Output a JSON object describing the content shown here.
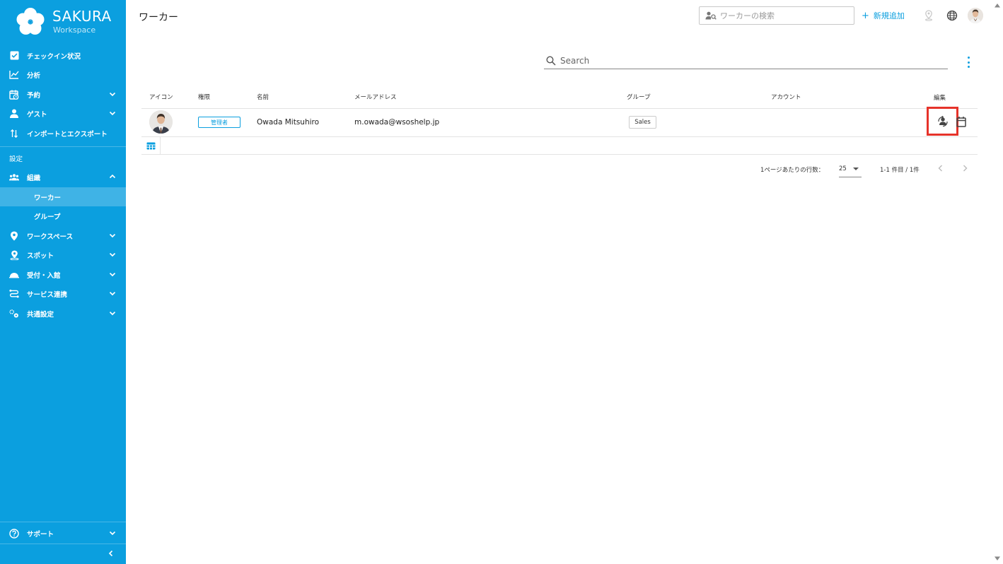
{
  "brand": {
    "title": "SAKURA",
    "subtitle": "Workspace"
  },
  "sidebar": {
    "items": [
      {
        "label": "チェックイン状況",
        "icon": "checkbox-icon"
      },
      {
        "label": "分析",
        "icon": "analytics-icon"
      },
      {
        "label": "予約",
        "icon": "calendar-clock-icon"
      },
      {
        "label": "ゲスト",
        "icon": "guest-icon"
      },
      {
        "label": "インポートとエクスポート",
        "icon": "import-export-icon"
      }
    ],
    "settings_label": "設定",
    "org": {
      "label": "組織",
      "icon": "people-icon"
    },
    "org_children": [
      {
        "label": "ワーカー",
        "active": true
      },
      {
        "label": "グループ",
        "active": false
      }
    ],
    "settings_items": [
      {
        "label": "ワークスペース",
        "icon": "location-pin-icon"
      },
      {
        "label": "スポット",
        "icon": "spot-icon"
      },
      {
        "label": "受付・入館",
        "icon": "reception-icon"
      },
      {
        "label": "サービス連携",
        "icon": "integration-icon"
      },
      {
        "label": "共通設定",
        "icon": "common-settings-icon"
      }
    ],
    "support": {
      "label": "サポート",
      "icon": "help-icon"
    }
  },
  "header": {
    "title": "ワーカー",
    "search_placeholder": "ワーカーの検索",
    "add_label": "新規追加"
  },
  "table": {
    "search_placeholder": "Search",
    "columns": [
      "アイコン",
      "権限",
      "名前",
      "メールアドレス",
      "グループ",
      "アカウント",
      "編集"
    ],
    "rows": [
      {
        "role": "管理者",
        "name": "Owada Mitsuhiro",
        "email": "m.owada@wsoshelp.jp",
        "group": "Sales",
        "account": ""
      }
    ]
  },
  "pagination": {
    "rows_per_page_label": "1ページあたりの行数：",
    "rows_per_page": "25",
    "range": "1-1 件目 / 1件"
  },
  "colors": {
    "sidebar": "#0b9fdf",
    "sidebar_active": "#3fb3e6",
    "accent": "#0b9fdf",
    "highlight": "#e6332a"
  }
}
